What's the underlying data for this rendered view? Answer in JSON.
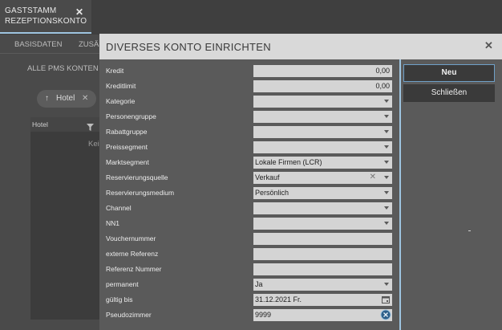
{
  "app": {
    "tab": {
      "line1": "GASTSTAMM",
      "line2": "REZEPTIONSKONTO"
    },
    "subtabs": [
      "BASISDATEN",
      "ZUSÄ"
    ],
    "section": "ALLE PMS KONTEN",
    "chip": "Hotel",
    "grid_header": "Hotel",
    "grid_empty": "Kei"
  },
  "dialog": {
    "title": "DIVERSES KONTO EINRICHTEN",
    "buttons": {
      "primary": "Neu",
      "secondary": "Schließen"
    },
    "fields": [
      {
        "label": "Kredit",
        "value": "0,00",
        "kind": "number"
      },
      {
        "label": "Kreditlimit",
        "value": "0,00",
        "kind": "number"
      },
      {
        "label": "Kategorie",
        "value": "",
        "kind": "select"
      },
      {
        "label": "Personengruppe",
        "value": "",
        "kind": "select"
      },
      {
        "label": "Rabattgruppe",
        "value": "",
        "kind": "select"
      },
      {
        "label": "Preissegment",
        "value": "",
        "kind": "select"
      },
      {
        "label": "Marktsegment",
        "value": "Lokale Firmen (LCR)",
        "kind": "select"
      },
      {
        "label": "Reservierungsquelle",
        "value": "Verkauf",
        "kind": "select-clear"
      },
      {
        "label": "Reservierungsmedium",
        "value": "Persönlich",
        "kind": "select"
      },
      {
        "label": "Channel",
        "value": "",
        "kind": "select"
      },
      {
        "label": "NN1",
        "value": "",
        "kind": "select"
      },
      {
        "label": "Vouchernummer",
        "value": "",
        "kind": "text"
      },
      {
        "label": "externe Referenz",
        "value": "",
        "kind": "text"
      },
      {
        "label": "Referenz Nummer",
        "value": "",
        "kind": "text"
      },
      {
        "label": "permanent",
        "value": "Ja",
        "kind": "select"
      },
      {
        "label": "gültig bis",
        "value": "31.12.2021 Fr.",
        "kind": "date"
      },
      {
        "label": "Pseudozimmer",
        "value": "9999",
        "kind": "clear"
      }
    ]
  },
  "colors": {
    "accent": "#9ec4e0",
    "dialog_bg": "#5a5a5a",
    "field_bg": "#d4d4d4"
  }
}
